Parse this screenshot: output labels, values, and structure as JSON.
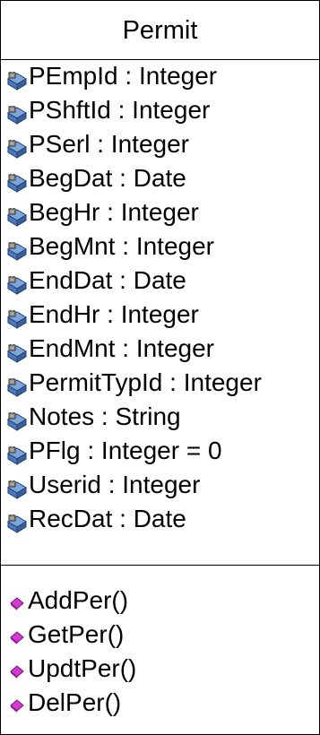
{
  "class": {
    "name": "Permit",
    "attributes": [
      {
        "text": "PEmpId : Integer",
        "icon": "protected-attribute-icon"
      },
      {
        "text": "PShftId : Integer",
        "icon": "protected-attribute-icon"
      },
      {
        "text": "PSerl : Integer",
        "icon": "protected-attribute-icon"
      },
      {
        "text": "BegDat : Date",
        "icon": "protected-attribute-icon"
      },
      {
        "text": "BegHr : Integer",
        "icon": "protected-attribute-icon"
      },
      {
        "text": "BegMnt : Integer",
        "icon": "protected-attribute-icon"
      },
      {
        "text": "EndDat : Date",
        "icon": "protected-attribute-icon"
      },
      {
        "text": "EndHr : Integer",
        "icon": "protected-attribute-icon"
      },
      {
        "text": "EndMnt : Integer",
        "icon": "protected-attribute-icon"
      },
      {
        "text": "PermitTypId : Integer",
        "icon": "protected-attribute-icon"
      },
      {
        "text": "Notes : String",
        "icon": "protected-attribute-icon"
      },
      {
        "text": "PFlg : Integer = 0",
        "icon": "protected-attribute-icon"
      },
      {
        "text": "Userid : Integer",
        "icon": "protected-attribute-icon"
      },
      {
        "text": "RecDat : Date",
        "icon": "protected-attribute-icon"
      }
    ],
    "operations": [
      {
        "text": "AddPer()",
        "icon": "public-operation-icon"
      },
      {
        "text": "GetPer()",
        "icon": "public-operation-icon"
      },
      {
        "text": "UpdtPer()",
        "icon": "public-operation-icon"
      },
      {
        "text": "DelPer()",
        "icon": "public-operation-icon"
      }
    ]
  },
  "colors": {
    "attribute_icon_fill": "#7fa6d6",
    "attribute_icon_key": "#d8b64a",
    "operation_icon_fill": "#d23ad2"
  }
}
